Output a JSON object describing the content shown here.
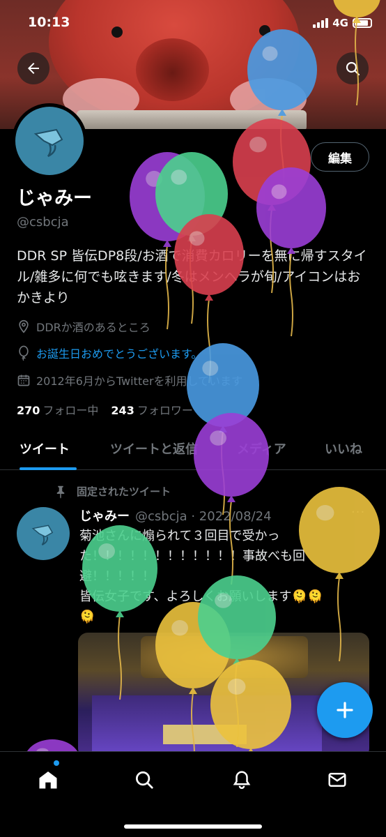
{
  "status_bar": {
    "time": "10:13",
    "network": "4G"
  },
  "banner": {
    "alt": ""
  },
  "profile": {
    "display_name": "じゃみー",
    "handle": "@csbcja",
    "edit_button": "編集",
    "bio": "DDR SP 皆伝DP8段/お酒で消費カロリーを無に帰すスタイル/雑多に何でも呟きます/冬はメンヘラが旬/アイコンはおかきより",
    "location": "DDRか酒のあるところ",
    "birthday": "お誕生日おめでとうございます。",
    "joined": "2012年6月からTwitterを利用しています",
    "following_count": "270",
    "following_label": "フォロー中",
    "followers_count": "243",
    "followers_label": "フォロワー"
  },
  "tabs": [
    {
      "label": "ツイート",
      "active": true
    },
    {
      "label": "ツイートと返信",
      "active": false
    },
    {
      "label": "メディア",
      "active": false
    },
    {
      "label": "いいね",
      "active": false
    }
  ],
  "pinned_tweet": {
    "pinned_label": "固定されたツイート",
    "author_name": "じゃみー",
    "author_meta": "@csbcja · 2022/08/24",
    "more": "···",
    "text": "菊池さんに煽られて３回目で受かった！！！！！！！！！！！！事故べも回避！！！！！\n皆伝女子です、よろしくお願いします🫠🫠\n🫠"
  },
  "icons": {
    "back": "arrow-left-icon",
    "search": "search-icon",
    "location": "location-pin-icon",
    "birthday": "balloon-icon",
    "calendar": "calendar-icon",
    "pin": "pin-icon",
    "compose": "plus-icon",
    "nav": [
      "home-icon",
      "search-icon",
      "bell-icon",
      "mail-icon"
    ]
  },
  "colors": {
    "accent": "#1d9bf0",
    "background": "#000000",
    "text": "#e7e9ea",
    "muted": "#71767b",
    "balloons": [
      "#4a9be3",
      "#d9404f",
      "#9b3fd6",
      "#4cd08e",
      "#ecc23e"
    ]
  }
}
